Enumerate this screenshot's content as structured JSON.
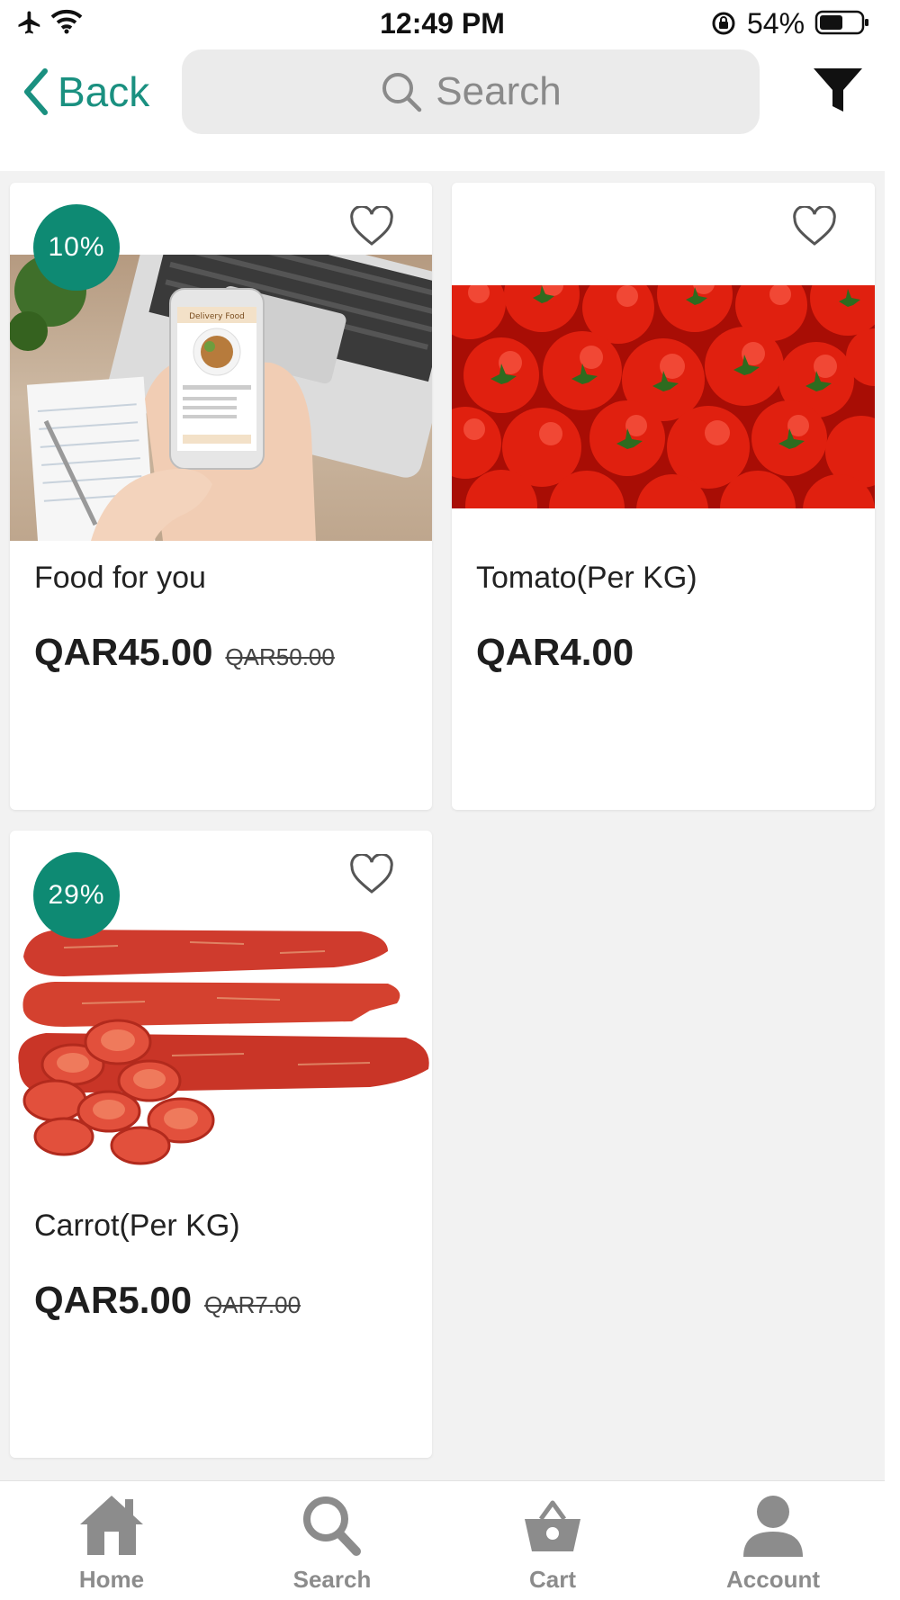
{
  "status_bar": {
    "time": "12:49 PM",
    "battery": "54%"
  },
  "nav": {
    "back_label": "Back",
    "search_placeholder": "Search"
  },
  "colors": {
    "accent": "#1a9080",
    "badge": "#0e8a73",
    "tab_icon": "#8c8c8c"
  },
  "products": [
    {
      "name": "Food for you",
      "price": "QAR45.00",
      "old_price": "QAR50.00",
      "discount": "10%",
      "image": "phone-food-app-photo"
    },
    {
      "name": "Tomato(Per KG)",
      "price": "QAR4.00",
      "old_price": "",
      "discount": "",
      "image": "tomatoes-photo"
    },
    {
      "name": "Carrot(Per KG)",
      "price": "QAR5.00",
      "old_price": "QAR7.00",
      "discount": "29%",
      "image": "red-carrots-photo"
    }
  ],
  "tabbar": {
    "items": [
      {
        "label": "Home",
        "icon": "home-icon"
      },
      {
        "label": "Search",
        "icon": "search-icon"
      },
      {
        "label": "Cart",
        "icon": "basket-icon"
      },
      {
        "label": "Account",
        "icon": "person-icon"
      }
    ]
  }
}
